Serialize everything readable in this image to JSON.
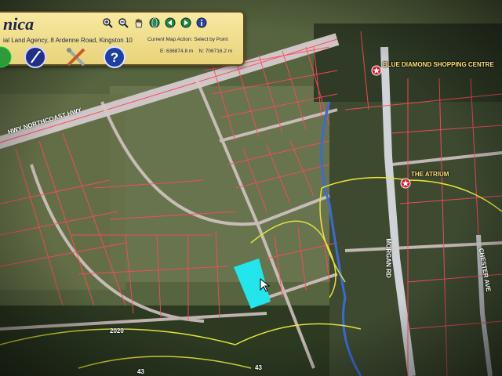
{
  "app": {
    "title_fragment": "nica",
    "agency": "ial Land Agency, 8 Ardenne Road, Kingston 10",
    "current_action": "Current Map Action: Select by Point",
    "easting": "E: 636874.8 m",
    "northing": "N: 706716.2 m"
  },
  "toolbar": {
    "nav_icons": [
      "zoom-in-icon",
      "zoom-out-icon",
      "pan-hand-icon",
      "back-arrow-icon",
      "forward-arrow-icon",
      "info-icon"
    ],
    "tool_icons": [
      "select-cursor-icon",
      "measure-tools-icon",
      "help-icon"
    ]
  },
  "map": {
    "road_labels": {
      "northcoast_hwy": "HWY NORTHCOAST HWY",
      "morgan_rd": "MORGAN RD",
      "chester_ave": "CHESTER AVE",
      "bottom_road": "2020",
      "bottom_codes": [
        "43",
        "43"
      ]
    },
    "poi": [
      {
        "name": "BLUE DIAMOND SHOPPING CENTRE",
        "icon": "star-marker-icon"
      },
      {
        "name": "THE ATRIUM",
        "icon": "star-marker-icon"
      }
    ],
    "selected_parcel_color": "#22e6ec",
    "parcel_line_color": "#ff4a5a",
    "boundary_color": "#e6e23c",
    "river_color": "#3a6ad8"
  }
}
